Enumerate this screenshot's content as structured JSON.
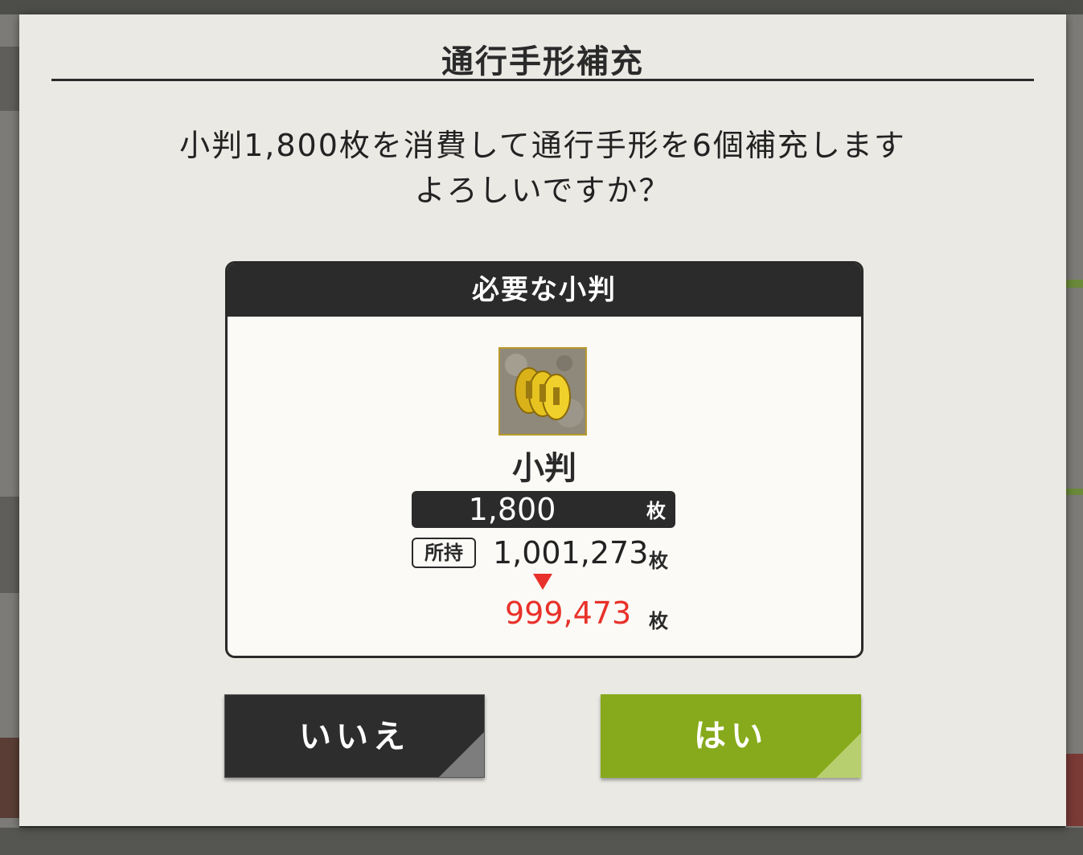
{
  "dialog": {
    "title": "通行手形補充",
    "message_line1": "小判1,800枚を消費して通行手形を6個補充します",
    "message_line2": "よろしいですか？"
  },
  "panel": {
    "header": "必要な小判",
    "item_icon": "koban-coins-icon",
    "item_name": "小判",
    "cost_value": "1,800",
    "cost_unit": "枚",
    "owned_label": "所持",
    "owned_value": "1,001,273",
    "owned_unit": "枚",
    "after_value": "999,473",
    "after_unit": "枚"
  },
  "buttons": {
    "no_label": "いいえ",
    "yes_label": "はい"
  },
  "colors": {
    "accent_green": "#86aa1b",
    "warning_red": "#e8312a",
    "dark": "#2b2b2b"
  }
}
